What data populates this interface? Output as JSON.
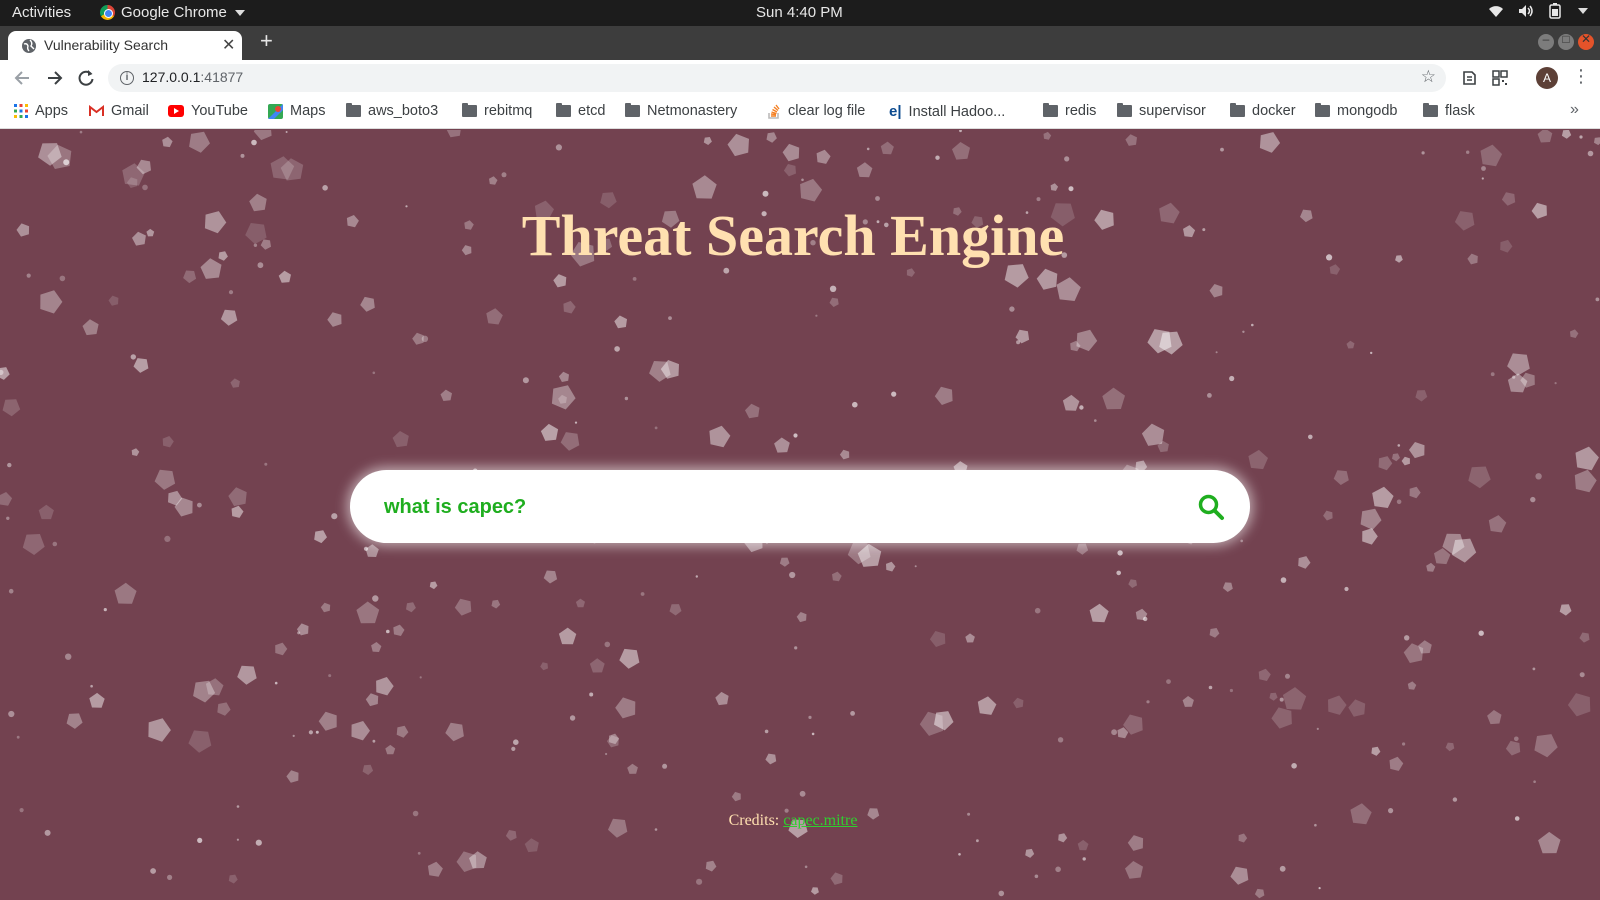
{
  "system_bar": {
    "activities": "Activities",
    "app_name": "Google Chrome",
    "clock": "Sun  4:40 PM"
  },
  "browser": {
    "tab_title": "Vulnerability Search",
    "url_host": "127.0.0.1",
    "url_port": ":41877",
    "avatar_letter": "A",
    "bookmarks": [
      {
        "label": "Apps",
        "icon": "apps-grid-icon"
      },
      {
        "label": "Gmail",
        "icon": "gmail-icon"
      },
      {
        "label": "YouTube",
        "icon": "youtube-icon"
      },
      {
        "label": "Maps",
        "icon": "maps-icon"
      },
      {
        "label": "aws_boto3",
        "icon": "folder-icon"
      },
      {
        "label": "rebitmq",
        "icon": "folder-icon"
      },
      {
        "label": "etcd",
        "icon": "folder-icon"
      },
      {
        "label": "Netmonastery",
        "icon": "folder-icon"
      },
      {
        "label": "clear log file",
        "icon": "stackoverflow-icon"
      },
      {
        "label": "Install Hadoo...",
        "icon": "edureka-icon"
      },
      {
        "label": "redis",
        "icon": "folder-icon"
      },
      {
        "label": "supervisor",
        "icon": "folder-icon"
      },
      {
        "label": "docker",
        "icon": "folder-icon"
      },
      {
        "label": "mongodb",
        "icon": "folder-icon"
      },
      {
        "label": "flask",
        "icon": "folder-icon"
      }
    ]
  },
  "page": {
    "heading": "Threat Search Engine",
    "search_value": "what is capec?",
    "credits_label": "Credits:",
    "credits_link": "capec.mitre"
  },
  "colors": {
    "background": "#734250",
    "heading": "#ffe0b0",
    "search_text": "#1fae1f",
    "link": "#2fcf2f"
  }
}
